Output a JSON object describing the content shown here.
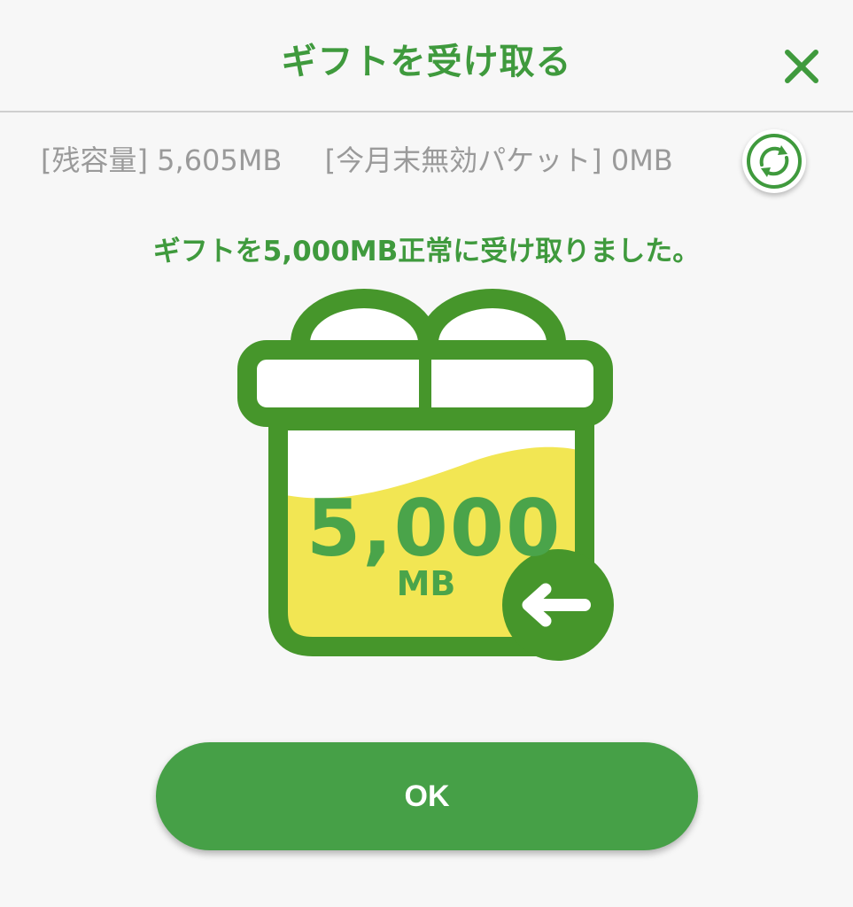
{
  "header": {
    "title": "ギフトを受け取る",
    "close_icon": "close-icon"
  },
  "status": {
    "remaining_label": "[残容量]",
    "remaining_value": "5,605MB",
    "expiring_label": "[今月末無効パケット]",
    "expiring_value": "0MB",
    "refresh_icon": "refresh-icon"
  },
  "message": "ギフトを5,000MB正常に受け取りました。",
  "gift": {
    "amount": "5,000",
    "unit": "MB",
    "icon": "gift-box-icon",
    "arrow_icon": "arrow-left-icon"
  },
  "actions": {
    "ok_label": "OK"
  },
  "colors": {
    "brand_green": "#3f9a3d",
    "button_green": "#46a047",
    "gift_fill_yellow": "#f2e653",
    "status_gray": "#9a9a9a"
  }
}
